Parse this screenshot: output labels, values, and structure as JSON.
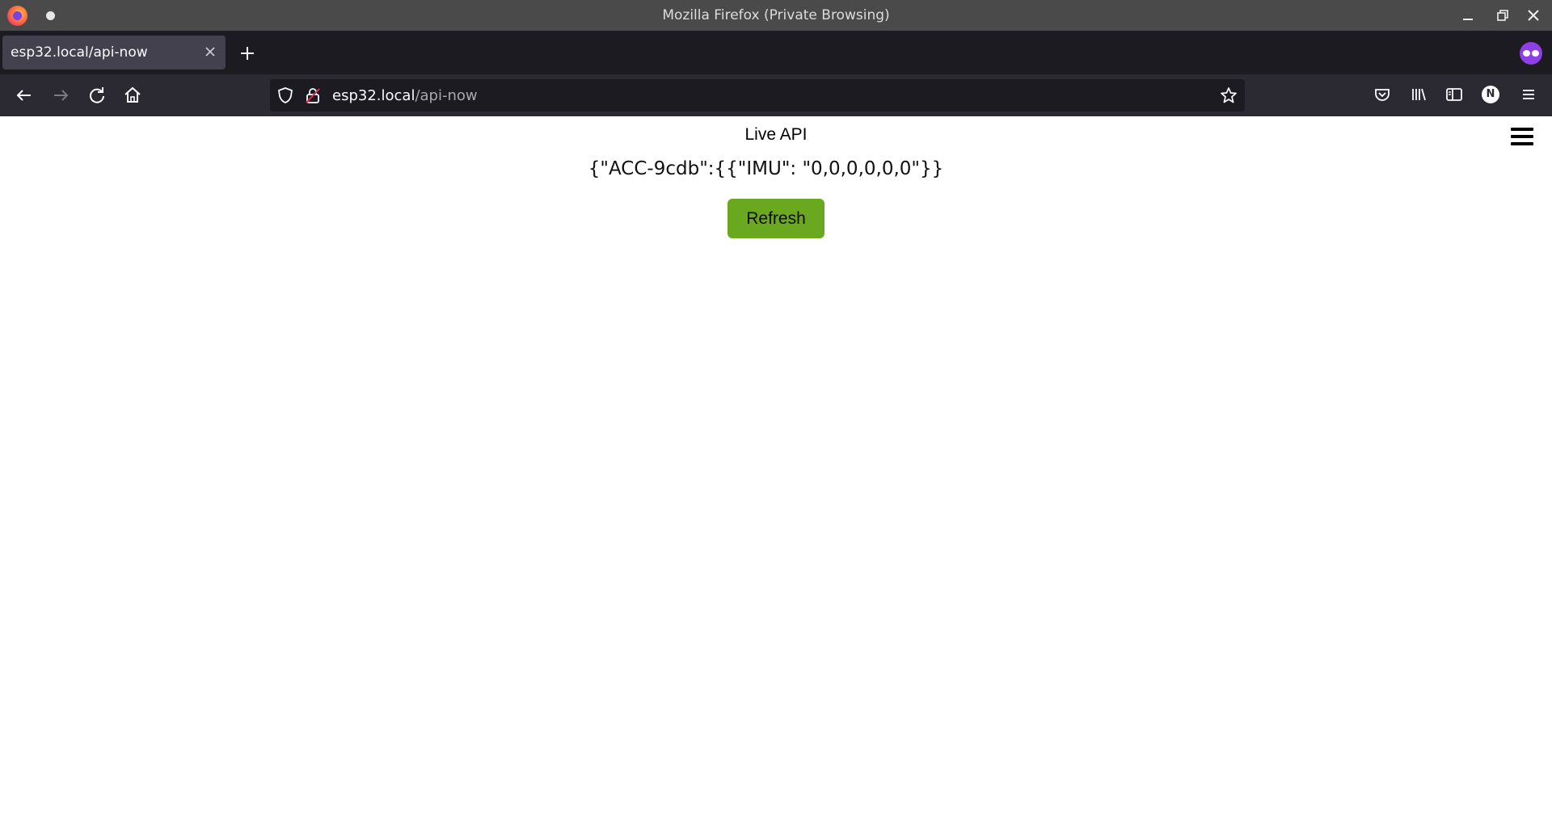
{
  "window": {
    "title": "Mozilla Firefox (Private Browsing)"
  },
  "tabs": [
    {
      "label": "esp32.local/api-now",
      "active": true
    }
  ],
  "urlbar": {
    "host": "esp32.local",
    "path": "/api-now"
  },
  "account": {
    "initial": "N"
  },
  "page": {
    "heading": "Live API",
    "api_output": "{\"ACC-9cdb\":{{\"IMU\": \"0,0,0,0,0,0\"}}",
    "refresh_label": "Refresh"
  },
  "colors": {
    "refresh_button": "#6aa820",
    "private_badge": "#8f3fe6",
    "toolbar": "#2b2a33",
    "tabstrip": "#1c1b22"
  },
  "icons": {
    "titlebar": [
      "firefox-logo-icon",
      "sticky-dot-icon",
      "minimize-icon",
      "maximize-icon",
      "close-icon"
    ],
    "tabstrip": [
      "tab-close-icon",
      "new-tab-icon",
      "private-browsing-icon"
    ],
    "navbar": [
      "back-icon",
      "forward-icon",
      "reload-icon",
      "home-icon",
      "shield-icon",
      "insecure-lock-icon",
      "bookmark-star-icon",
      "pocket-icon",
      "library-icon",
      "sidebar-icon",
      "account-icon",
      "app-menu-icon"
    ],
    "page": [
      "hamburger-menu-icon"
    ]
  }
}
